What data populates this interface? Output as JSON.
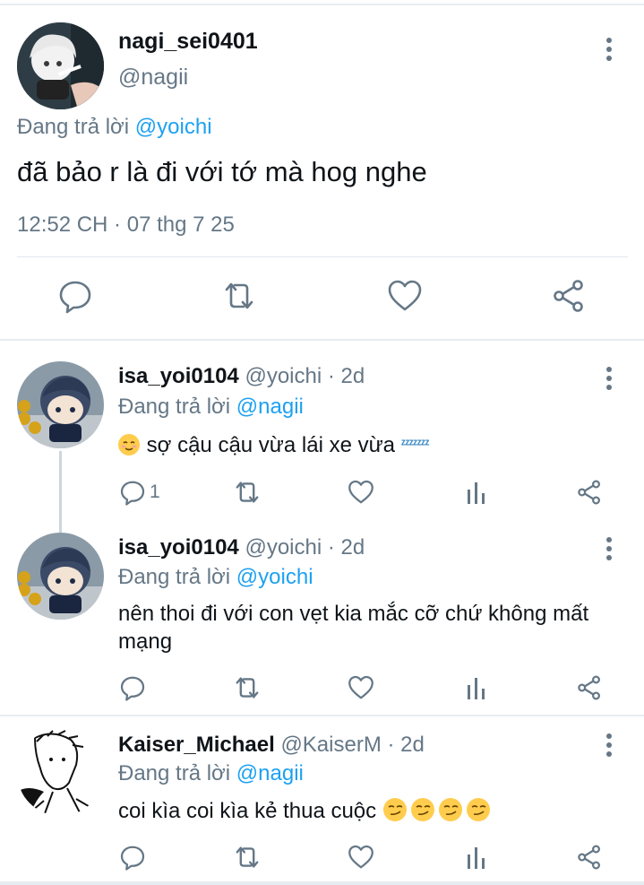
{
  "main_tweet": {
    "display_name": "nagi_sei0401",
    "handle": "@nagii",
    "replying_prefix": "Đang trả lời",
    "replying_to": "@yoichi",
    "text": "đã bảo r là đi với tớ mà hog nghe",
    "timestamp": "12:52 CH · 07 thg 7 25",
    "actions": [
      "reply-icon",
      "retweet-icon",
      "like-icon",
      "share-icon"
    ]
  },
  "replies": [
    {
      "display_name": "isa_yoi0104",
      "handle": "@yoichi",
      "time": "· 2d",
      "replying_prefix": "Đang trả lời",
      "replying_to": "@nagii",
      "text_emoji": "relieved-face-emoji",
      "text": "sợ cậu cậu vừa lái xe vừa",
      "text_suffix_emoji": "zzz-emoji",
      "reply_count": "1"
    },
    {
      "display_name": "isa_yoi0104",
      "handle": "@yoichi",
      "time": "· 2d",
      "replying_prefix": "Đang trả lời",
      "replying_to": "@yoichi",
      "text": "nên thoi đi với con vẹt kia mắc cỡ chứ không mất mạng",
      "reply_count": ""
    },
    {
      "display_name": "Kaiser_Michael",
      "handle": "@KaiserM",
      "time": "· 2d",
      "replying_prefix": "Đang trả lời",
      "replying_to": "@nagii",
      "text": "coi kìa coi kìa kẻ thua cuộc",
      "text_suffix_emoji": "smirking-face-emoji x4",
      "reply_count": ""
    }
  ],
  "colors": {
    "accent": "#1da1f2",
    "secondary_text": "#657786",
    "icon": "#657786",
    "divider": "#e6ecf0"
  }
}
